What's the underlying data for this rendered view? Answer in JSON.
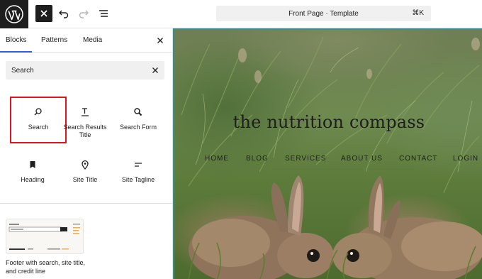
{
  "topbar": {
    "logo": "wordpress-logo",
    "close_icon": "close-icon",
    "undo_icon": "undo-icon",
    "redo_icon": "redo-icon",
    "document_overview_icon": "list-view-icon",
    "command_title": "Front Page · Template",
    "command_shortcut": "⌘K"
  },
  "sidebar": {
    "tabs": [
      {
        "label": "Blocks",
        "active": true
      },
      {
        "label": "Patterns",
        "active": false
      },
      {
        "label": "Media",
        "active": false
      }
    ],
    "search": {
      "value": "Search",
      "placeholder": "Search"
    },
    "blocks": [
      {
        "label": "Search",
        "icon": "search-icon",
        "highlighted": true
      },
      {
        "label": "Search Results Title",
        "icon": "title-icon",
        "highlighted": false
      },
      {
        "label": "Search Form",
        "icon": "search-form-icon",
        "highlighted": false
      },
      {
        "label": "Heading",
        "icon": "bookmark-icon",
        "highlighted": false
      },
      {
        "label": "Site Title",
        "icon": "map-marker-icon",
        "highlighted": false
      },
      {
        "label": "Site Tagline",
        "icon": "tagline-icon",
        "highlighted": false
      }
    ],
    "pattern": {
      "label": "Footer with search, site title, and credit line"
    }
  },
  "canvas": {
    "site_title": "the nutrition compass",
    "nav": [
      "HOME",
      "BLOG",
      "SERVICES",
      "ABOUT US",
      "CONTACT",
      "LOGIN"
    ]
  },
  "colors": {
    "accent": "#3858e9",
    "highlight": "#e0141e",
    "canvas_border": "#3e8c8c",
    "dark": "#1e1e1e"
  }
}
